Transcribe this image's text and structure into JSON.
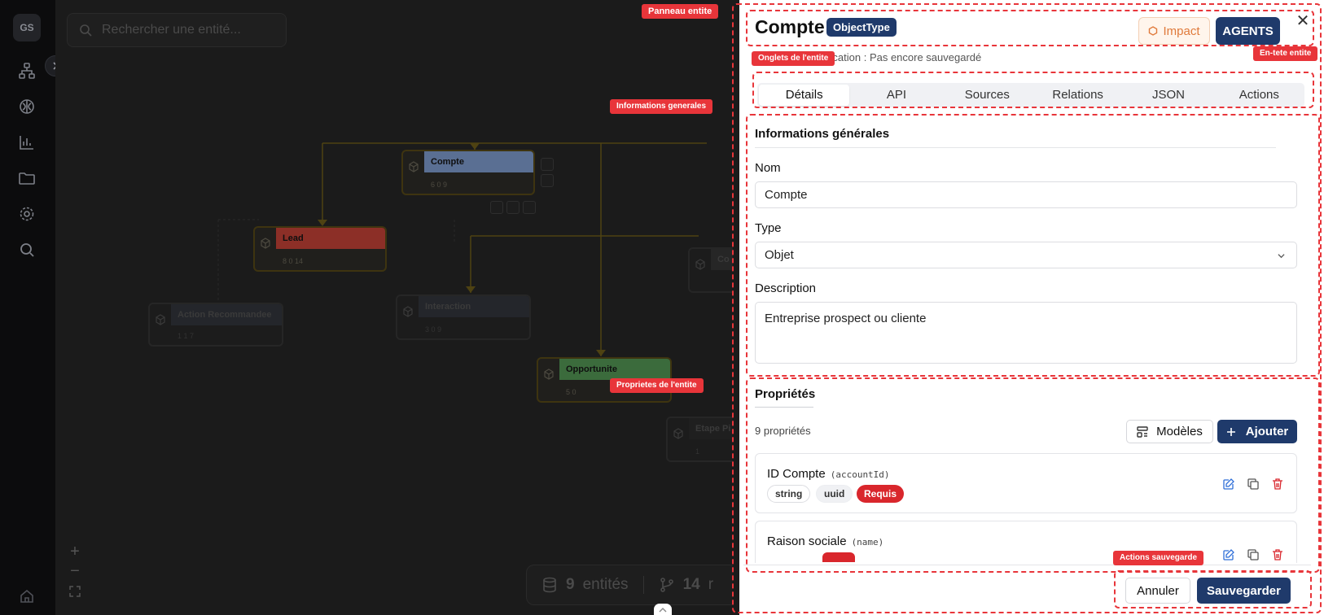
{
  "rail": {
    "logo": "GS",
    "icons": [
      "graph-icon",
      "brain-icon",
      "chart-icon",
      "folder-icon",
      "settings-icon",
      "search-icon",
      "home-icon"
    ]
  },
  "canvas": {
    "search_placeholder": "Rechercher une entité...",
    "nodes": [
      {
        "label": "Compte",
        "stats": "6  0  9",
        "color": "#5a6f93"
      },
      {
        "label": "Lead",
        "stats": "8  0  14",
        "color": "#8c2f27"
      },
      {
        "label": "Co",
        "stats": "",
        "color": "#262626"
      },
      {
        "label": "Action Recommandee",
        "stats": "1  1  7",
        "color": "#2a2d33"
      },
      {
        "label": "Interaction",
        "stats": "3  0  9",
        "color": "#2a2d33"
      },
      {
        "label": "Opportunite",
        "stats": "5  0",
        "color": "#3b6b3c"
      },
      {
        "label": "Etape Pi",
        "stats": "1",
        "color": "#262626"
      }
    ],
    "zoom": {
      "in": "+",
      "out": "−"
    },
    "stats": {
      "entities_count": "9",
      "entities_label": "entités",
      "relations_count": "14",
      "relations_label": "r"
    }
  },
  "panel": {
    "title": "Compte",
    "type_badge": "ObjectType",
    "impact_label": "Impact",
    "agents_label": "AGENTS",
    "close_label": "✕",
    "modif_label": "ification :",
    "modif_value": "Pas encore sauvegardé",
    "tabs": [
      {
        "label": "Détails",
        "active": true
      },
      {
        "label": "API",
        "active": false
      },
      {
        "label": "Sources",
        "active": false
      },
      {
        "label": "Relations",
        "active": false
      },
      {
        "label": "JSON",
        "active": false
      },
      {
        "label": "Actions",
        "active": false
      }
    ],
    "general": {
      "title": "Informations générales",
      "name_label": "Nom",
      "name_value": "Compte",
      "type_label": "Type",
      "type_value": "Objet",
      "desc_label": "Description",
      "desc_value": "Entreprise prospect ou cliente"
    },
    "properties": {
      "title": "Propriétés",
      "count": "9 propriétés",
      "models_label": "Modèles",
      "add_label": "Ajouter",
      "items": [
        {
          "name": "ID Compte",
          "key": "(accountId)",
          "tags": [
            "string",
            "uuid",
            "Requis"
          ]
        },
        {
          "name": "Raison sociale",
          "key": "(name)",
          "tags": []
        }
      ]
    },
    "footer": {
      "cancel_label": "Annuler",
      "save_label": "Sauvegarder"
    }
  },
  "annotations": {
    "panel": "Panneau entite",
    "tabs": "Onglets de l'entite",
    "header": "En-tete entite",
    "general": "Informations generales",
    "properties": "Proprietes de l'entite",
    "save": "Actions sauvegarde"
  },
  "colors": {
    "accent": "#1f3a6b",
    "danger": "#d9262c",
    "annotation": "#e8353a",
    "impact": "#e07a3b"
  }
}
